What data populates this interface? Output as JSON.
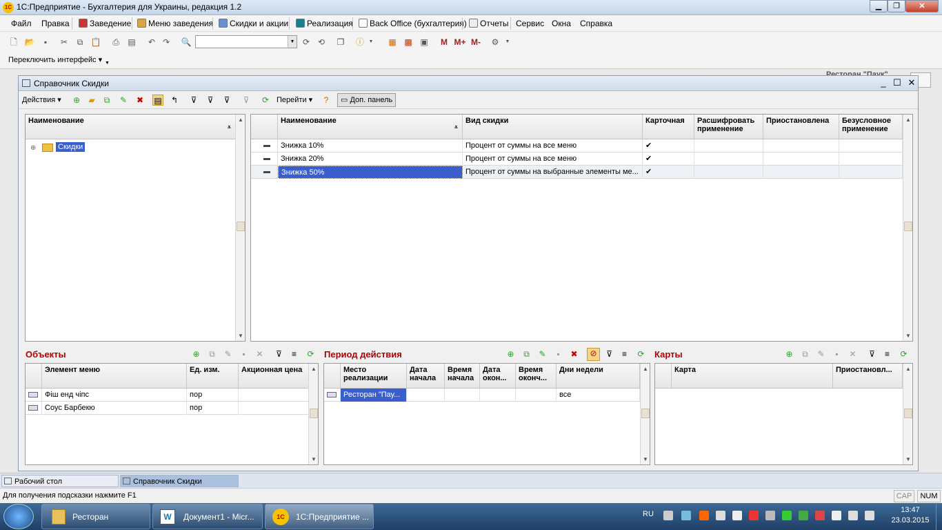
{
  "app": {
    "title": "1С:Предприятие - Бухгалтерия для Украины, редакция 1.2",
    "logo_text": "1С"
  },
  "menu": [
    "Файл",
    "Правка",
    "Заведение",
    "Меню заведения",
    "Скидки и акции",
    "Реализация",
    "Back Office (бухгалтерия)",
    "Отчеты",
    "Сервис",
    "Окна",
    "Справка"
  ],
  "switch_interface": "Переключить интерфейс",
  "toolbar_letters": {
    "m": "M",
    "mplus": "M+",
    "mminus": "M-"
  },
  "background_title": "Ресторан \"Паук\"",
  "window": {
    "title": "Справочник Скидки",
    "actions": {
      "actions_label": "Действия",
      "goto_label": "Перейти",
      "panel_label": "Доп. панель"
    }
  },
  "tree": {
    "header": "Наименование",
    "items": [
      {
        "label": "Скидки"
      }
    ]
  },
  "discounts": {
    "headers": [
      "Наименование",
      "Вид скидки",
      "Карточная",
      "Расшифровать применение",
      "Приостановлена",
      "Безусловное применение"
    ],
    "rows": [
      {
        "name": "Знижка 10%",
        "kind": "Процент от суммы на все меню",
        "card": "✔"
      },
      {
        "name": "Знижка 20%",
        "kind": "Процент от суммы на все меню",
        "card": "✔"
      },
      {
        "name": "Знижка 50%",
        "kind": "Процент от суммы на выбранные элементы ме...",
        "card": "✔"
      }
    ]
  },
  "objects": {
    "title": "Объекты",
    "headers": [
      "Элемент меню",
      "Ед. изм.",
      "Акционная цена"
    ],
    "rows": [
      {
        "item": "Фіш енд чіпс",
        "unit": "пор"
      },
      {
        "item": "Соус Барбекю",
        "unit": "пор"
      }
    ]
  },
  "period": {
    "title": "Период действия",
    "headers": [
      "Место реализации",
      "Дата начала",
      "Время начала",
      "Дата окон...",
      "Время оконч...",
      "Дни недели"
    ],
    "rows": [
      {
        "place": "Ресторан \"Пау...",
        "days": "все"
      }
    ]
  },
  "cards": {
    "title": "Карты",
    "headers": [
      "Карта",
      "Приостановл..."
    ]
  },
  "tabs": [
    "Рабочий стол",
    "Справочник Скидки"
  ],
  "status": {
    "hint": "Для получения подсказки нажмите F1",
    "cap": "CAP",
    "num": "NUM"
  },
  "taskbar": {
    "items": [
      "Ресторан",
      "Документ1 - Micr...",
      "1С:Предприятие ..."
    ],
    "lang": "RU",
    "time": "13:47",
    "date": "23.03.2015"
  }
}
